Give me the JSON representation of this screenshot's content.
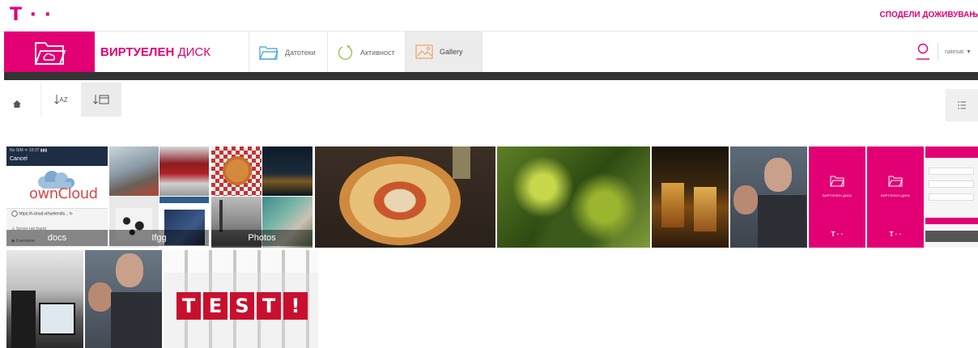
{
  "topbar": {
    "logo": "T · ·",
    "share_label": "СПОДЕЛИ ДОЖИВУВАЊ"
  },
  "header": {
    "title_bold": "ВИРТУЕЛЕН",
    "title_rest": " ДИСК",
    "tabs": [
      {
        "label": "Датотеки",
        "icon": "folder-icon",
        "active": false
      },
      {
        "label": "Активност",
        "icon": "refresh-icon",
        "active": false
      },
      {
        "label": "Gallery",
        "icon": "image-icon",
        "active": true
      }
    ],
    "user": {
      "name": "natesat",
      "caret": "▼"
    }
  },
  "toolbar": {
    "sort_az_label": "AZ",
    "sort_date_label": "",
    "icons": [
      "home-icon",
      "sort-alpha-icon",
      "sort-date-icon",
      "list-view-icon"
    ]
  },
  "gallery": {
    "albums": [
      {
        "label": "docs"
      },
      {
        "label": "Ifgg"
      },
      {
        "label": "Photos"
      }
    ],
    "phone_screenshot": {
      "status": "No SIM ᯤ          10:37          ▮▮▮",
      "cancel": "Cancel",
      "brand": "ownCloud",
      "url": "https://t-cloud.virtuelendis...",
      "server": "Server not found",
      "username": "Username"
    },
    "pink_tiles": [
      {
        "caption": "ВИРТУЕЛЕН ДИСК",
        "mark": "T · ·"
      },
      {
        "caption": "ВИРТУЕЛЕН ДИСК",
        "mark": "T · ·"
      }
    ],
    "test_keys": [
      "T",
      "E",
      "S",
      "T",
      "!"
    ],
    "colors": {
      "magenta": "#e20074",
      "tab_accent": "#f2a05e"
    }
  }
}
